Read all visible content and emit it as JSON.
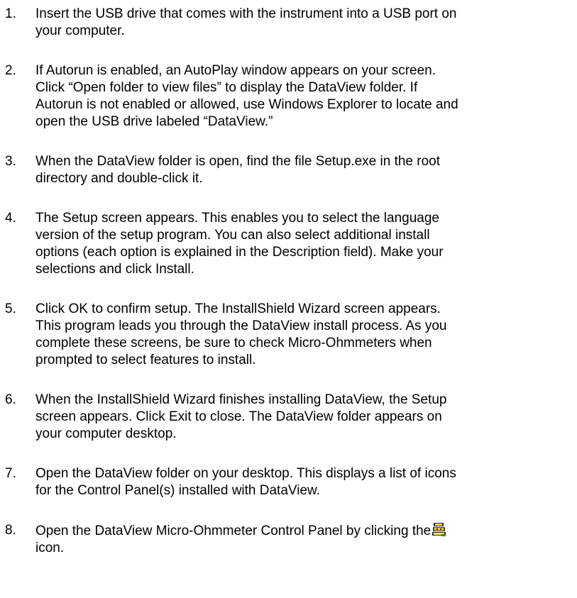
{
  "steps": [
    {
      "num": "1.",
      "lines": [
        "Insert the USB drive that comes with the instrument into a USB port on",
        "your computer."
      ]
    },
    {
      "num": "2.",
      "lines": [
        "If Autorun is enabled, an AutoPlay window appears on your screen.",
        "Click “Open folder to view files” to display the DataView folder. If",
        "Autorun is not enabled or allowed, use Windows Explorer to locate and",
        "open the USB drive labeled “DataView.”"
      ]
    },
    {
      "num": "3.",
      "lines": [
        "When the DataView folder is open, find the file Setup.exe in the root",
        "directory and double-click it."
      ]
    },
    {
      "num": "4.",
      "lines": [
        "The Setup screen appears. This enables you to select the language",
        "version of the setup program. You can also select additional install",
        "options (each option is explained in the Description field). Make your",
        "selections and click Install."
      ]
    },
    {
      "num": "5.",
      "lines": [
        "Click OK to confirm setup. The InstallShield Wizard screen appears.",
        "This program leads you through the DataView install process. As you",
        "complete these screens, be sure to check Micro-Ohmmeters when",
        "prompted to select features to install."
      ]
    },
    {
      "num": "6.",
      "lines": [
        "When the InstallShield Wizard finishes installing DataView, the Setup",
        "screen appears. Click Exit to close. The DataView folder appears on",
        "your computer desktop."
      ]
    },
    {
      "num": "7.",
      "lines": [
        "Open the DataView folder on your desktop. This displays a list of icons",
        "for the Control Panel(s) installed with DataView."
      ]
    },
    {
      "num": "8.",
      "line1": "Open the DataView Micro-Ohmmeter Control Panel by clicking the",
      "icon": "dataview-micro-ohmmeter-control-panel-icon",
      "line2": "icon."
    }
  ]
}
